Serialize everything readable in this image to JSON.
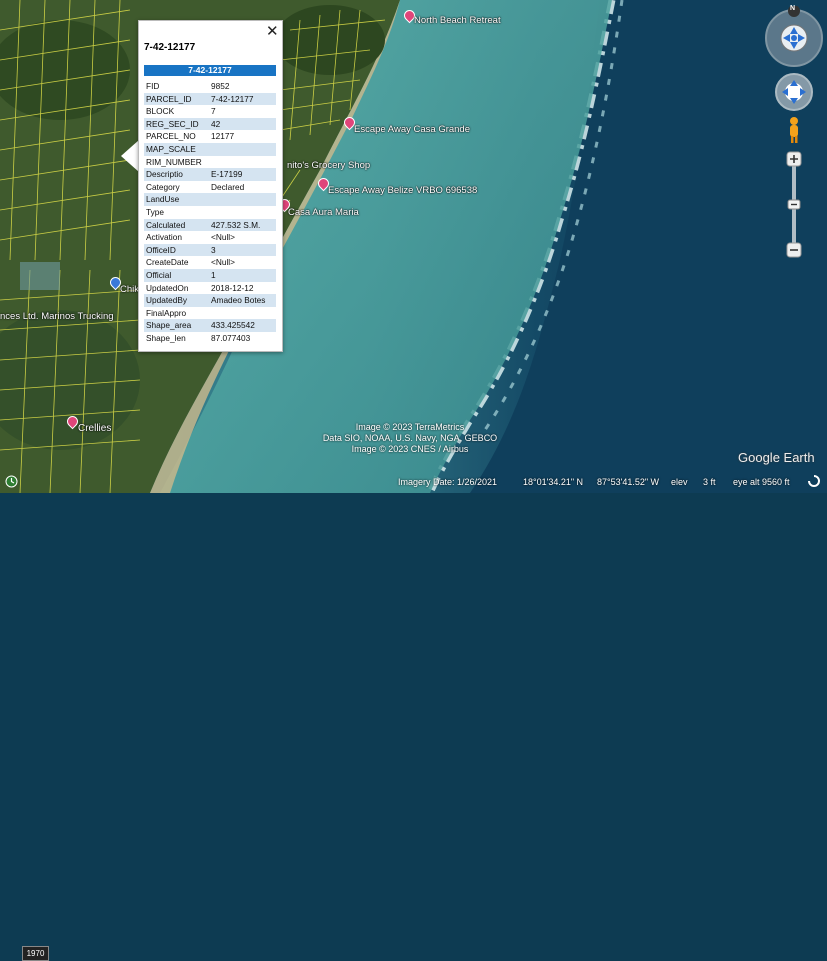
{
  "popup": {
    "title": "7-42-12177",
    "header": "7-42-12177",
    "close": "✕",
    "rows": [
      {
        "k": "FID",
        "v": "9852"
      },
      {
        "k": "PARCEL_ID",
        "v": "7-42-12177"
      },
      {
        "k": "BLOCK",
        "v": "7"
      },
      {
        "k": "REG_SEC_ID",
        "v": "42"
      },
      {
        "k": "PARCEL_NO",
        "v": "12177"
      },
      {
        "k": "MAP_SCALE",
        "v": ""
      },
      {
        "k": "RIM_NUMBER",
        "v": ""
      },
      {
        "k": "Descriptio",
        "v": "E-17199"
      },
      {
        "k": "Category",
        "v": "Declared"
      },
      {
        "k": "LandUse",
        "v": ""
      },
      {
        "k": "Type",
        "v": ""
      },
      {
        "k": "Calculated",
        "v": "427.532 S.M."
      },
      {
        "k": "Activation",
        "v": "<Null>"
      },
      {
        "k": "OfficeID",
        "v": "3"
      },
      {
        "k": "CreateDate",
        "v": "<Null>"
      },
      {
        "k": "Official",
        "v": "1"
      },
      {
        "k": "UpdatedOn",
        "v": "2018-12-12"
      },
      {
        "k": "UpdatedBy",
        "v": "Amadeo Botes"
      },
      {
        "k": "FinalAppro",
        "v": ""
      },
      {
        "k": "Shape_area",
        "v": "433.425542"
      },
      {
        "k": "Shape_len",
        "v": "87.077403"
      }
    ]
  },
  "places": {
    "north_beach": "North Beach Retreat",
    "escape_grande": "Escape Away Casa Grande",
    "grocery": "nito's Grocery Shop",
    "escape_vrbo": "Escape Away Belize VRBO 696538",
    "casa_aura": "Casa Aura Maria",
    "chik": "Chik",
    "marinos": "nces Ltd. Marinos Trucking",
    "crellies": "Crellies"
  },
  "attribution": {
    "line1": "Image © 2023 TerraMetrics",
    "line2": "Data SIO, NOAA, U.S. Navy, NGA, GEBCO",
    "line3": "Image © 2023 CNES / Airbus"
  },
  "brand": "Google Earth",
  "status": {
    "year": "1970",
    "imagery_date": "Imagery Date: 1/26/2021",
    "lat": "18°01'34.21\" N",
    "lon": "87°53'41.52\" W",
    "elev_label": "elev",
    "elev": "3 ft",
    "eye_alt": "eye alt  9560 ft"
  },
  "nav": {
    "north": "N"
  },
  "icons": {
    "compass": "compass-ring-icon",
    "pan": "hand-pan-icon",
    "streetview": "pegman-icon",
    "zoom_in": "plus-icon",
    "zoom_out": "minus-icon",
    "loading": "spinner-icon"
  },
  "colors": {
    "popup_header": "#1874c4",
    "row_stripe": "#d5e4f1",
    "pin": "#e0457a",
    "parcel_lines": "#e3e34a"
  }
}
